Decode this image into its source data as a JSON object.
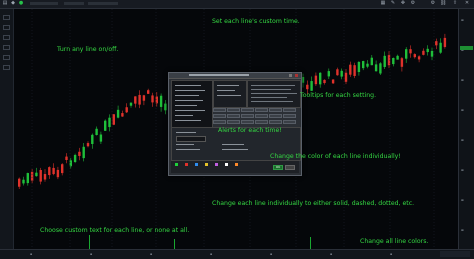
{
  "annotations": {
    "custom_time": "Set each line's custom time.",
    "turn_on_off": "Turn any line on/off.",
    "tooltips": "Tooltips for each setting.",
    "alerts": "Alerts for each time!",
    "color_line": "Change the color of each line individually!",
    "line_style": "Change each line individually to either solid, dashed, dotted, etc.",
    "custom_text": "Choose custom text for each line, or none at all.",
    "all_colors": "Change all line colors."
  },
  "dialog": {
    "ok_label": "OK"
  },
  "colors": {
    "annotation_text": "#35d843",
    "bull_candle": "#1fbf3a",
    "bear_candle": "#e0322b",
    "dialog_bg": "#2b2f35"
  },
  "icons": [
    "grid-icon",
    "drawing-icon",
    "cursor-icon",
    "settings-icon",
    "close-icon",
    "gear-icon"
  ]
}
